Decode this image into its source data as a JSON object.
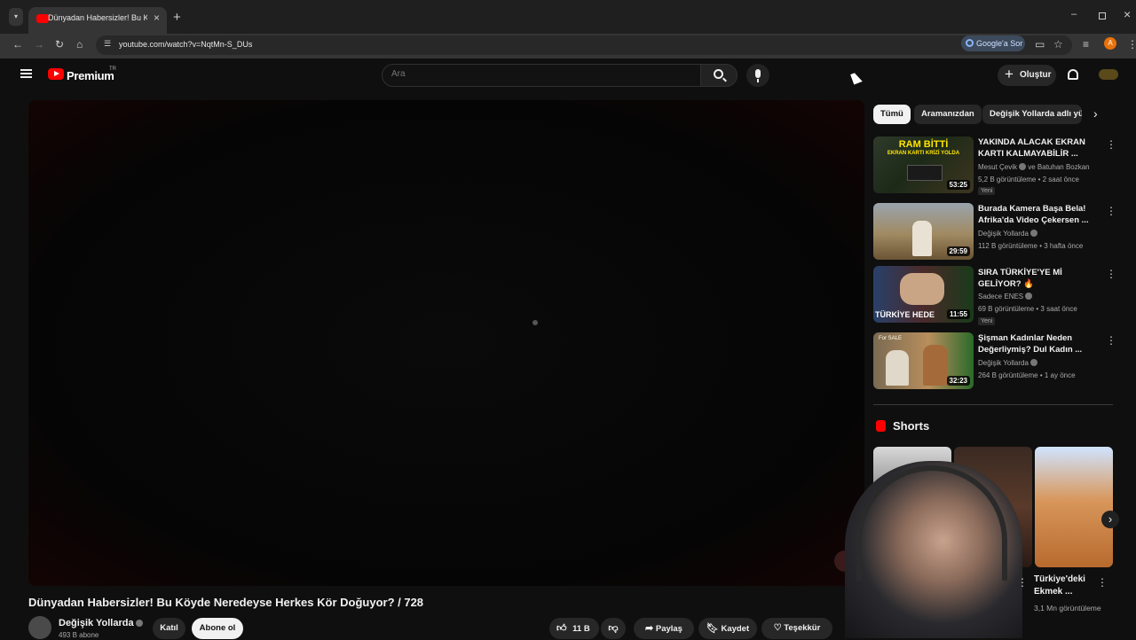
{
  "browser": {
    "tab_title": "Dünyadan Habersizler! Bu Köyde",
    "url": "youtube.com/watch?v=NqtMn-S_DUs",
    "google_btn": "Google'a Sor",
    "profile_letter": "A"
  },
  "header": {
    "brand": "Premium",
    "brand_region": "TR",
    "search_placeholder": "Ara",
    "create_label": "Oluştur"
  },
  "video": {
    "title": "Dünyadan Habersizler! Bu Köyde Neredeyse Herkes Kör Doğuyor? / 728",
    "channel": "Değişik Yollarda",
    "subscribers": "493 B abone",
    "join_label": "Katıl",
    "subscribe_label": "Abone ol",
    "likes": "11 B",
    "share_label": "Paylaş",
    "save_label": "Kaydet",
    "thanks_label": "Teşekkür"
  },
  "chips": [
    "Tümü",
    "Aramanızdan",
    "Değişik Yollarda adlı yük"
  ],
  "recommendations": [
    {
      "title": "YAKINDA ALACAK EKRAN KARTI KALMAYABİLİR ...",
      "channel": "Mesut Çevik",
      "channel_extra": "ve Batuhan Bozkan",
      "meta": "5,2 B görüntüleme • 2 saat önce",
      "badge": "Yeni",
      "duration": "53:25",
      "thumb_text_1": "RAM BİTTİ",
      "thumb_text_2": "EKRAN KARTI KRİZİ YOLDA"
    },
    {
      "title": "Burada Kamera Başa Bela! Afrika'da Video Çekersen ...",
      "channel": "Değişik Yollarda",
      "meta": "112 B görüntüleme • 3 hafta önce",
      "duration": "29:59"
    },
    {
      "title": "SIRA TÜRKİYE'YE Mİ GELİYOR? 🔥",
      "channel": "Sadece ENES",
      "meta": "69 B görüntüleme • 3 saat önce",
      "badge": "Yeni",
      "duration": "11:55",
      "thumb_text_1": "TÜRKİYE HEDE"
    },
    {
      "title": "Şişman Kadınlar Neden Değerliymiş? Dul Kadın ...",
      "channel": "Değişik Yollarda",
      "meta": "264 B görüntüleme • 1 ay önce",
      "duration": "32:23",
      "thumb_text_1": "For SALE"
    }
  ],
  "shorts": {
    "heading": "Shorts",
    "item_title": "Türkiye'deki Ekmek ...",
    "item_views": "3,1 Mn görüntüleme"
  },
  "colors": {
    "bg": "#0f0f0f",
    "brand_red": "#ff0000",
    "chip_active": "#f1f1f1"
  }
}
